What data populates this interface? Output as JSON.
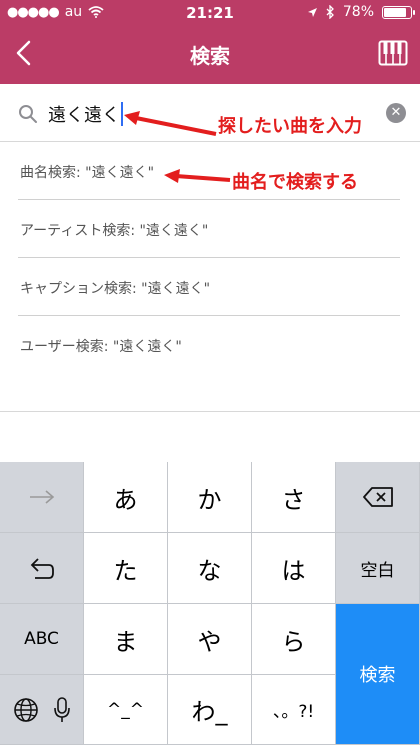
{
  "status": {
    "carrier": "au",
    "time": "21:21",
    "battery": "78%",
    "battery_level": 0.78
  },
  "nav": {
    "title": "検索",
    "back_icon": "chevron-left-icon",
    "right_icon": "piano-icon"
  },
  "search": {
    "query": "遠く遠く",
    "clear_icon": "clear-icon"
  },
  "annotations": {
    "input_hint": "探したい曲を入力",
    "title_hint": "曲名で検索する"
  },
  "results": [
    "曲名検索: \"遠く遠く\"",
    "アーティスト検索: \"遠く遠く\"",
    "キャプション検索: \"遠く遠く\"",
    "ユーザー検索: \"遠く遠く\""
  ],
  "keyboard": {
    "row1": [
      "あ",
      "か",
      "さ"
    ],
    "row2": [
      "た",
      "な",
      "は"
    ],
    "row3": [
      "ま",
      "や",
      "ら"
    ],
    "row4": [
      "^_^",
      "わ_",
      "、。?!"
    ],
    "abc": "ABC",
    "space": "空白",
    "search": "検索",
    "accent_color": "#1e8df7"
  }
}
